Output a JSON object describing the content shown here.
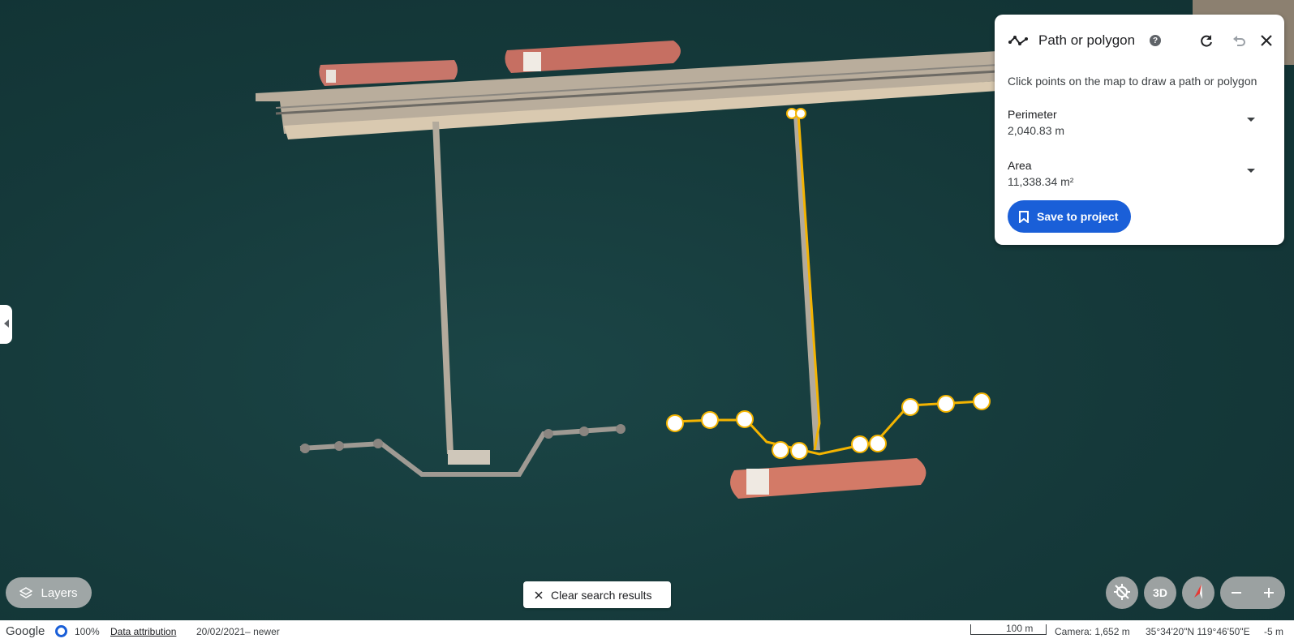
{
  "panel": {
    "title": "Path or polygon",
    "help_glyph": "?",
    "hint": "Click points on the map to draw a path or polygon",
    "perimeter_label": "Perimeter",
    "perimeter_value": "2,040.83 m",
    "area_label": "Area",
    "area_value": "11,338.34 m²",
    "save_label": "Save to project"
  },
  "map": {
    "layers_label": "Layers",
    "clear_label": "Clear search results",
    "tilt_label": "3D"
  },
  "footer": {
    "brand": "Google",
    "load_percent": "100%",
    "attribution": "Data attribution",
    "imagery_dates": "20/02/2021– newer",
    "scale": "100 m",
    "camera": "Camera: 1,652 m",
    "coordinates": "35°34'20\"N 119°46'50\"E",
    "elevation": "-5 m"
  },
  "colors": {
    "accent": "#1a5fd8",
    "path": "#f4b400",
    "water": "#163c3d"
  },
  "icons": [
    "path-polygon-icon",
    "help-icon",
    "refresh-icon",
    "undo-icon",
    "close-icon",
    "dropdown-icon",
    "bookmark-icon",
    "layers-icon",
    "clear-icon",
    "location-off-icon",
    "compass-icon",
    "zoom-out-icon",
    "zoom-in-icon",
    "collapse-icon"
  ]
}
